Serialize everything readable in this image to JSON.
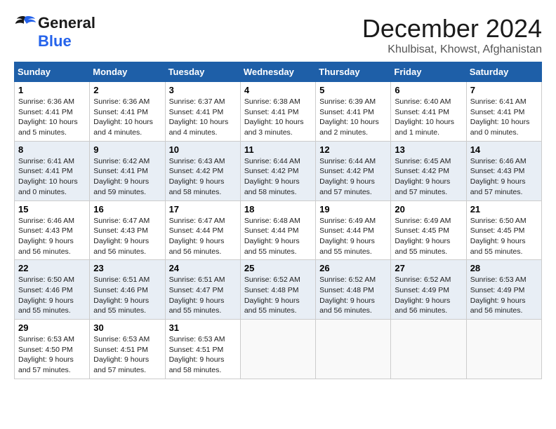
{
  "header": {
    "logo_line1": "General",
    "logo_line2": "Blue",
    "month": "December 2024",
    "location": "Khulbisat, Khowst, Afghanistan"
  },
  "days_of_week": [
    "Sunday",
    "Monday",
    "Tuesday",
    "Wednesday",
    "Thursday",
    "Friday",
    "Saturday"
  ],
  "weeks": [
    [
      {
        "day": "1",
        "sunrise": "6:36 AM",
        "sunset": "4:41 PM",
        "daylight": "10 hours and 5 minutes."
      },
      {
        "day": "2",
        "sunrise": "6:36 AM",
        "sunset": "4:41 PM",
        "daylight": "10 hours and 4 minutes."
      },
      {
        "day": "3",
        "sunrise": "6:37 AM",
        "sunset": "4:41 PM",
        "daylight": "10 hours and 4 minutes."
      },
      {
        "day": "4",
        "sunrise": "6:38 AM",
        "sunset": "4:41 PM",
        "daylight": "10 hours and 3 minutes."
      },
      {
        "day": "5",
        "sunrise": "6:39 AM",
        "sunset": "4:41 PM",
        "daylight": "10 hours and 2 minutes."
      },
      {
        "day": "6",
        "sunrise": "6:40 AM",
        "sunset": "4:41 PM",
        "daylight": "10 hours and 1 minute."
      },
      {
        "day": "7",
        "sunrise": "6:41 AM",
        "sunset": "4:41 PM",
        "daylight": "10 hours and 0 minutes."
      }
    ],
    [
      {
        "day": "8",
        "sunrise": "6:41 AM",
        "sunset": "4:41 PM",
        "daylight": "10 hours and 0 minutes."
      },
      {
        "day": "9",
        "sunrise": "6:42 AM",
        "sunset": "4:41 PM",
        "daylight": "9 hours and 59 minutes."
      },
      {
        "day": "10",
        "sunrise": "6:43 AM",
        "sunset": "4:42 PM",
        "daylight": "9 hours and 58 minutes."
      },
      {
        "day": "11",
        "sunrise": "6:44 AM",
        "sunset": "4:42 PM",
        "daylight": "9 hours and 58 minutes."
      },
      {
        "day": "12",
        "sunrise": "6:44 AM",
        "sunset": "4:42 PM",
        "daylight": "9 hours and 57 minutes."
      },
      {
        "day": "13",
        "sunrise": "6:45 AM",
        "sunset": "4:42 PM",
        "daylight": "9 hours and 57 minutes."
      },
      {
        "day": "14",
        "sunrise": "6:46 AM",
        "sunset": "4:43 PM",
        "daylight": "9 hours and 57 minutes."
      }
    ],
    [
      {
        "day": "15",
        "sunrise": "6:46 AM",
        "sunset": "4:43 PM",
        "daylight": "9 hours and 56 minutes."
      },
      {
        "day": "16",
        "sunrise": "6:47 AM",
        "sunset": "4:43 PM",
        "daylight": "9 hours and 56 minutes."
      },
      {
        "day": "17",
        "sunrise": "6:47 AM",
        "sunset": "4:44 PM",
        "daylight": "9 hours and 56 minutes."
      },
      {
        "day": "18",
        "sunrise": "6:48 AM",
        "sunset": "4:44 PM",
        "daylight": "9 hours and 55 minutes."
      },
      {
        "day": "19",
        "sunrise": "6:49 AM",
        "sunset": "4:44 PM",
        "daylight": "9 hours and 55 minutes."
      },
      {
        "day": "20",
        "sunrise": "6:49 AM",
        "sunset": "4:45 PM",
        "daylight": "9 hours and 55 minutes."
      },
      {
        "day": "21",
        "sunrise": "6:50 AM",
        "sunset": "4:45 PM",
        "daylight": "9 hours and 55 minutes."
      }
    ],
    [
      {
        "day": "22",
        "sunrise": "6:50 AM",
        "sunset": "4:46 PM",
        "daylight": "9 hours and 55 minutes."
      },
      {
        "day": "23",
        "sunrise": "6:51 AM",
        "sunset": "4:46 PM",
        "daylight": "9 hours and 55 minutes."
      },
      {
        "day": "24",
        "sunrise": "6:51 AM",
        "sunset": "4:47 PM",
        "daylight": "9 hours and 55 minutes."
      },
      {
        "day": "25",
        "sunrise": "6:52 AM",
        "sunset": "4:48 PM",
        "daylight": "9 hours and 55 minutes."
      },
      {
        "day": "26",
        "sunrise": "6:52 AM",
        "sunset": "4:48 PM",
        "daylight": "9 hours and 56 minutes."
      },
      {
        "day": "27",
        "sunrise": "6:52 AM",
        "sunset": "4:49 PM",
        "daylight": "9 hours and 56 minutes."
      },
      {
        "day": "28",
        "sunrise": "6:53 AM",
        "sunset": "4:49 PM",
        "daylight": "9 hours and 56 minutes."
      }
    ],
    [
      {
        "day": "29",
        "sunrise": "6:53 AM",
        "sunset": "4:50 PM",
        "daylight": "9 hours and 57 minutes."
      },
      {
        "day": "30",
        "sunrise": "6:53 AM",
        "sunset": "4:51 PM",
        "daylight": "9 hours and 57 minutes."
      },
      {
        "day": "31",
        "sunrise": "6:53 AM",
        "sunset": "4:51 PM",
        "daylight": "9 hours and 58 minutes."
      },
      null,
      null,
      null,
      null
    ]
  ]
}
